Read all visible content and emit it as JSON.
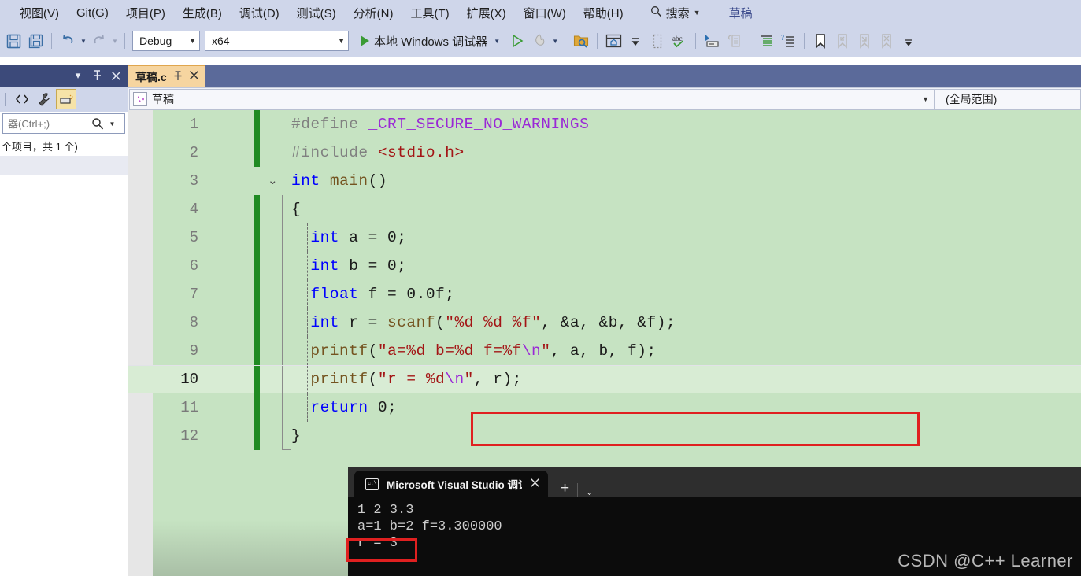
{
  "menubar": {
    "items": [
      "视图(V)",
      "Git(G)",
      "项目(P)",
      "生成(B)",
      "调试(D)",
      "测试(S)",
      "分析(N)",
      "工具(T)",
      "扩展(X)",
      "窗口(W)",
      "帮助(H)"
    ],
    "search_label": "搜索",
    "doc_title": "草稿"
  },
  "toolbar": {
    "config_value": "Debug",
    "platform_value": "x64",
    "run_label": "本地 Windows 调试器"
  },
  "solution_explorer": {
    "search_placeholder": "器(Ctrl+;)",
    "status": "个项目，共 1 个)"
  },
  "editor": {
    "tab_label": "草稿.c",
    "scope_file": "草稿",
    "scope_member": "(全局范围)",
    "lines": [
      {
        "n": "1",
        "segments": [
          {
            "t": "#define ",
            "c": "t-pp"
          },
          {
            "t": "_CRT_SECURE_NO_WARNINGS",
            "c": "t-mac"
          }
        ]
      },
      {
        "n": "2",
        "segments": [
          {
            "t": "#include ",
            "c": "t-pp"
          },
          {
            "t": "<stdio.h>",
            "c": "t-inc"
          }
        ]
      },
      {
        "n": "3",
        "segments": [
          {
            "t": "int ",
            "c": "t-kw"
          },
          {
            "t": "main",
            "c": "t-fn"
          },
          {
            "t": "()",
            "c": "t-plain"
          }
        ]
      },
      {
        "n": "4",
        "segments": [
          {
            "t": "{",
            "c": "t-plain"
          }
        ]
      },
      {
        "n": "5",
        "segments": [
          {
            "t": "int",
            "c": "t-kw"
          },
          {
            "t": " a = 0;",
            "c": "t-plain"
          }
        ]
      },
      {
        "n": "6",
        "segments": [
          {
            "t": "int",
            "c": "t-kw"
          },
          {
            "t": " b = 0;",
            "c": "t-plain"
          }
        ]
      },
      {
        "n": "7",
        "segments": [
          {
            "t": "float",
            "c": "t-kw"
          },
          {
            "t": " f = 0.0f;",
            "c": "t-plain"
          }
        ]
      },
      {
        "n": "8",
        "segments": [
          {
            "t": "int",
            "c": "t-kw"
          },
          {
            "t": " r = ",
            "c": "t-plain"
          },
          {
            "t": "scanf",
            "c": "t-fn"
          },
          {
            "t": "(",
            "c": "t-plain"
          },
          {
            "t": "\"%d %d %f\"",
            "c": "t-str"
          },
          {
            "t": ", &a, &b, &f);",
            "c": "t-plain"
          }
        ]
      },
      {
        "n": "9",
        "segments": [
          {
            "t": "printf",
            "c": "t-fn"
          },
          {
            "t": "(",
            "c": "t-plain"
          },
          {
            "t": "\"a=%d b=%d f=%f",
            "c": "t-str"
          },
          {
            "t": "\\n",
            "c": "t-esc"
          },
          {
            "t": "\"",
            "c": "t-str"
          },
          {
            "t": ", a, b, f);",
            "c": "t-plain"
          }
        ]
      },
      {
        "n": "10",
        "segments": [
          {
            "t": "printf",
            "c": "t-fn"
          },
          {
            "t": "(",
            "c": "t-plain"
          },
          {
            "t": "\"r = %d",
            "c": "t-str"
          },
          {
            "t": "\\n",
            "c": "t-esc"
          },
          {
            "t": "\"",
            "c": "t-str"
          },
          {
            "t": ", r);",
            "c": "t-plain"
          }
        ]
      },
      {
        "n": "11",
        "segments": [
          {
            "t": "return",
            "c": "t-kw"
          },
          {
            "t": " 0;",
            "c": "t-plain"
          }
        ]
      },
      {
        "n": "12",
        "segments": [
          {
            "t": "}",
            "c": "t-plain"
          }
        ]
      }
    ],
    "current_line": "10"
  },
  "console": {
    "tab_title": "Microsoft Visual Studio 调试控",
    "output": "1 2 3.3\na=1 b=2 f=3.300000\nr = 3"
  },
  "watermark": "CSDN @C++ Learner",
  "colors": {
    "accent_chrome": "#cfd6ea",
    "editor_bg": "#c6e3c2",
    "tab_active": "#f6d5a0",
    "highlight_red": "#e02020",
    "change_bar_green": "#1f8b22",
    "console_bg": "#0c0c0c"
  }
}
